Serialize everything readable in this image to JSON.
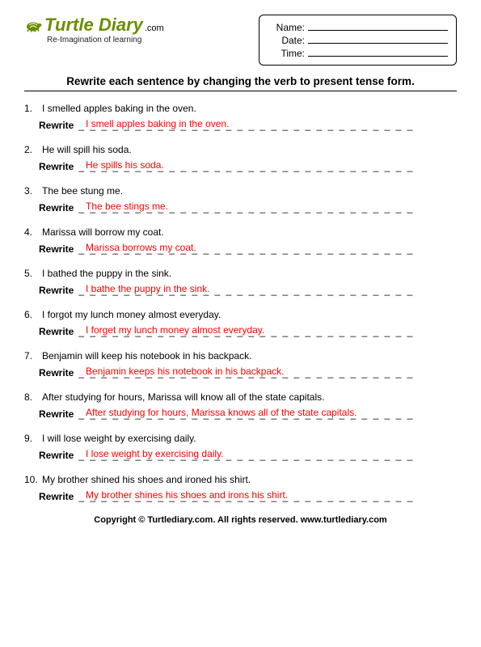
{
  "logo": {
    "name_part1": "T",
    "name_part2": "urtle Diary",
    "dotcom": ".com",
    "tagline": "Re-Imagination of learning"
  },
  "meta": {
    "name_label": "Name:",
    "date_label": "Date:",
    "time_label": "Time:"
  },
  "instruction": "Rewrite each sentence by changing the verb to present tense form.",
  "rewrite_label": "Rewrite",
  "dashes": "_ _ _ _ _ _ _ _ _ _ _ _ _ _ _ _ _ _ _ _ _ _ _ _ _ _ _ _ _ _",
  "questions": [
    {
      "n": "1.",
      "prompt": "I smelled apples baking in the oven.",
      "answer": "I smell apples baking in the oven."
    },
    {
      "n": "2.",
      "prompt": "He will spill his soda.",
      "answer": "He spills his soda."
    },
    {
      "n": "3.",
      "prompt": "The bee stung me.",
      "answer": "The bee stings me."
    },
    {
      "n": "4.",
      "prompt": "Marissa will borrow my coat.",
      "answer": "Marissa borrows my coat."
    },
    {
      "n": "5.",
      "prompt": "I bathed the puppy in the sink.",
      "answer": "I bathe the puppy in the sink."
    },
    {
      "n": "6.",
      "prompt": "I forgot my lunch money almost everyday.",
      "answer": "I forget my lunch money almost everyday."
    },
    {
      "n": "7.",
      "prompt": "Benjamin will keep his notebook in his backpack.",
      "answer": "Benjamin keeps his notebook in his backpack."
    },
    {
      "n": "8.",
      "prompt": "After studying for hours, Marissa will know all of the state capitals.",
      "answer": "After studying for hours, Marissa knows all of the state capitals."
    },
    {
      "n": "9.",
      "prompt": "I will lose weight by exercising daily.",
      "answer": "I lose weight by exercising daily."
    },
    {
      "n": "10.",
      "prompt": "My brother shined his shoes and ironed his shirt.",
      "answer": "My brother shines his shoes and irons his shirt."
    }
  ],
  "footer": "Copyright © Turtlediary.com. All rights reserved. www.turtlediary.com"
}
